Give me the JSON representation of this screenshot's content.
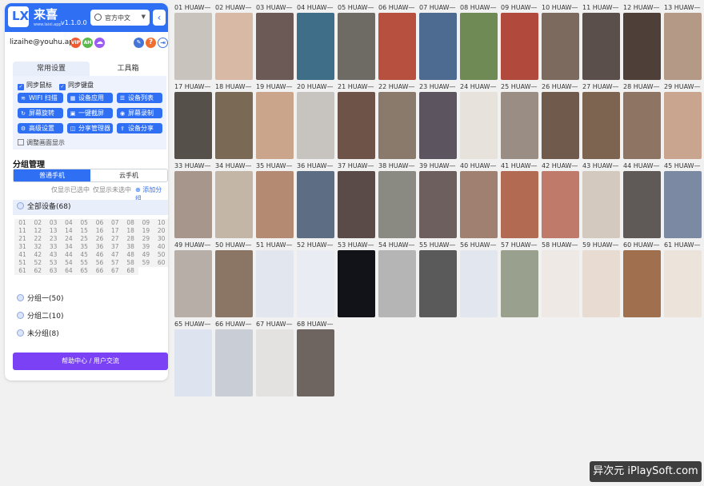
{
  "header": {
    "logo_text": "LX",
    "app_name": "来喜",
    "site": "www.laixi.app",
    "version": "v1.1.0.0",
    "language": "官方中文"
  },
  "user": {
    "email": "lizaihe@youhu.app",
    "badges": [
      "VIP",
      "AH"
    ]
  },
  "tabs": [
    "常用设置",
    "工具箱"
  ],
  "checkboxes": [
    "同步鼠标",
    "同步键盘"
  ],
  "function_buttons": [
    {
      "label": "WIFI 扫描",
      "icon": "wifi-icon"
    },
    {
      "label": "设备应用",
      "icon": "apps-icon"
    },
    {
      "label": "设备列表",
      "icon": "list-icon"
    },
    {
      "label": "屏幕旋转",
      "icon": "rotate-icon"
    },
    {
      "label": "一键截屏",
      "icon": "screenshot-icon"
    },
    {
      "label": "屏幕录制",
      "icon": "record-icon"
    },
    {
      "label": "高级设置",
      "icon": "settings-icon"
    },
    {
      "label": "分享管理器",
      "icon": "share-manager-icon"
    },
    {
      "label": "设备分享",
      "icon": "share-icon"
    }
  ],
  "adjust_display": "调整画面显示",
  "group_title": "分组管理",
  "device_types": [
    "普通手机",
    "云手机"
  ],
  "filters": [
    "仅显示已选中",
    "仅显示未选中"
  ],
  "add_group": "添加分组",
  "all_devices": "全部设备(68)",
  "group_numbers": [
    "01",
    "02",
    "03",
    "04",
    "05",
    "06",
    "07",
    "08",
    "09",
    "10",
    "11",
    "12",
    "13",
    "14",
    "15",
    "16",
    "17",
    "18",
    "19",
    "20",
    "21",
    "22",
    "23",
    "24",
    "25",
    "26",
    "27",
    "28",
    "29",
    "30",
    "31",
    "32",
    "33",
    "34",
    "35",
    "36",
    "37",
    "38",
    "39",
    "40",
    "41",
    "42",
    "43",
    "44",
    "45",
    "46",
    "47",
    "48",
    "49",
    "50",
    "51",
    "52",
    "53",
    "54",
    "55",
    "56",
    "57",
    "58",
    "59",
    "60",
    "61",
    "62",
    "63",
    "64",
    "65",
    "66",
    "67",
    "68"
  ],
  "groups": [
    "分组一(50)",
    "分组二(10)",
    "未分组(8)"
  ],
  "help_button": "帮助中心 / 用户交流",
  "devices": [
    {
      "label": "01 HUAW—",
      "color": "#c9c3bd"
    },
    {
      "label": "02 HUAW—",
      "color": "#d8b9a6"
    },
    {
      "label": "03 HUAW—",
      "color": "#6b5a55"
    },
    {
      "label": "04 HUAW—",
      "color": "#3e6e88"
    },
    {
      "label": "05 HUAW—",
      "color": "#6e6a64"
    },
    {
      "label": "06 HUAW—",
      "color": "#b8503f"
    },
    {
      "label": "07 HUAW—",
      "color": "#4d6a91"
    },
    {
      "label": "08 HUAW—",
      "color": "#6f8a55"
    },
    {
      "label": "09 HUAW—",
      "color": "#b14a3c"
    },
    {
      "label": "10 HUAW—",
      "color": "#7d6a5e"
    },
    {
      "label": "11 HUAW—",
      "color": "#5b4f4c"
    },
    {
      "label": "12 HUAW—",
      "color": "#4e3f38"
    },
    {
      "label": "13 HUAW—",
      "color": "#b49a86"
    },
    {
      "label": "17 HUAW—",
      "color": "#56504a"
    },
    {
      "label": "18 HUAW—",
      "color": "#7a6a55"
    },
    {
      "label": "19 HUAW—",
      "color": "#caa58b"
    },
    {
      "label": "20 HUAW—",
      "color": "#c7c4c0"
    },
    {
      "label": "21 HUAW—",
      "color": "#6e5448"
    },
    {
      "label": "22 HUAW—",
      "color": "#8a7a6c"
    },
    {
      "label": "23 HUAW—",
      "color": "#5c5560"
    },
    {
      "label": "24 HUAW—",
      "color": "#e8e2dc"
    },
    {
      "label": "25 HUAW—",
      "color": "#9a8e84"
    },
    {
      "label": "26 HUAW—",
      "color": "#6f5a4c"
    },
    {
      "label": "27 HUAW—",
      "color": "#7c6450"
    },
    {
      "label": "28 HUAW—",
      "color": "#8d7463"
    },
    {
      "label": "29 HUAW—",
      "color": "#c9a58f"
    },
    {
      "label": "33 HUAW—",
      "color": "#a7968b"
    },
    {
      "label": "34 HUAW—",
      "color": "#c3b6a6"
    },
    {
      "label": "35 HUAW—",
      "color": "#b48a72"
    },
    {
      "label": "36 HUAW—",
      "color": "#5d6e84"
    },
    {
      "label": "37 HUAW—",
      "color": "#5a4a48"
    },
    {
      "label": "38 HUAW—",
      "color": "#8a8a82"
    },
    {
      "label": "39 HUAW—",
      "color": "#6c5f5e"
    },
    {
      "label": "40 HUAW—",
      "color": "#a08070"
    },
    {
      "label": "41 HUAW—",
      "color": "#b36a52"
    },
    {
      "label": "42 HUAW—",
      "color": "#c07a6a"
    },
    {
      "label": "43 HUAW—",
      "color": "#d3c9be"
    },
    {
      "label": "44 HUAW—",
      "color": "#5f5a58"
    },
    {
      "label": "45 HUAW—",
      "color": "#7b8aa2"
    },
    {
      "label": "49 HUAW—",
      "color": "#b7afa7"
    },
    {
      "label": "50 HUAW—",
      "color": "#8b7666"
    },
    {
      "label": "51 HUAW—",
      "color": "#e2e6ef"
    },
    {
      "label": "52 HUAW—",
      "color": "#e9ecf2"
    },
    {
      "label": "53 HUAW—",
      "color": "#111318"
    },
    {
      "label": "54 HUAW—",
      "color": "#b5b5b5"
    },
    {
      "label": "55 HUAW—",
      "color": "#5a5a5a"
    },
    {
      "label": "56 HUAW—",
      "color": "#e2e6ef"
    },
    {
      "label": "57 HUAW—",
      "color": "#9aa08e"
    },
    {
      "label": "58 HUAW—",
      "color": "#efe9e6"
    },
    {
      "label": "59 HUAW—",
      "color": "#e8dcd2"
    },
    {
      "label": "60 HUAW—",
      "color": "#a0704e"
    },
    {
      "label": "61 HUAW—",
      "color": "#ece3da"
    },
    {
      "label": "65 HUAW—",
      "color": "#dde4f0"
    },
    {
      "label": "66 HUAW—",
      "color": "#c9cdd6"
    },
    {
      "label": "67 HUAW—",
      "color": "#e3e2e0"
    },
    {
      "label": "68 HUAW—",
      "color": "#6e6560"
    }
  ],
  "watermark": "异次元 iPlaySoft.com"
}
